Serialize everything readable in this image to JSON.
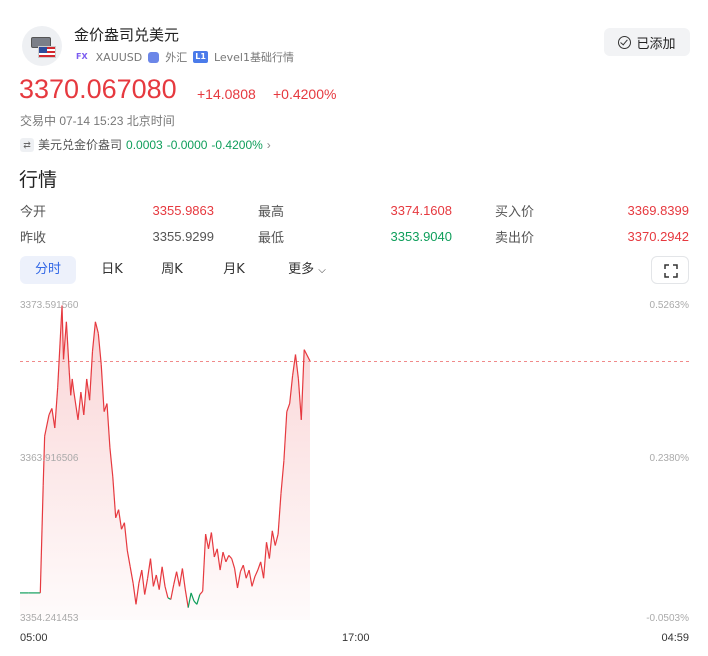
{
  "header": {
    "name": "金价盎司兑美元",
    "tag_fx": "FX",
    "code": "XAUUSD",
    "market": "外汇",
    "level_tag": "L1",
    "level": "Level1基础行情",
    "added_label": "已添加"
  },
  "quote": {
    "price": "3370.067080",
    "change": "+14.0808",
    "change_pct": "+0.4200%",
    "status": "交易中 07-14 15:23 北京时间"
  },
  "related": {
    "name": "美元兑金价盎司",
    "price": "0.0003",
    "change": "-0.0000",
    "change_pct": "-0.4200%"
  },
  "section_title": "行情",
  "stats": {
    "open_label": "今开",
    "open": "3355.9863",
    "high_label": "最高",
    "high": "3374.1608",
    "bid_label": "买入价",
    "bid": "3369.8399",
    "prev_label": "昨收",
    "prev": "3355.9299",
    "low_label": "最低",
    "low": "3353.9040",
    "ask_label": "卖出价",
    "ask": "3370.2942"
  },
  "tabs": {
    "intraday": "分时",
    "day": "日K",
    "week": "周K",
    "month": "月K",
    "more": "更多"
  },
  "colors": {
    "up": "#e6393f",
    "down": "#0f9e5b",
    "accent": "#3268e6"
  },
  "chart_data": {
    "type": "line",
    "y_left_ticks": [
      "3373.591560",
      "3363.916506",
      "3354.241453"
    ],
    "y_right_ticks": [
      "0.5263%",
      "0.2380%",
      "-0.0503%"
    ],
    "x_ticks": [
      "05:00",
      "17:00",
      "04:59"
    ],
    "ylim": [
      3354.241453,
      3373.59156
    ],
    "prev_close": 3355.9299,
    "current": 3370.06708,
    "x": [
      0.0,
      0.03,
      0.07,
      0.08,
      0.085,
      0.1,
      0.11,
      0.12,
      0.13,
      0.145,
      0.15,
      0.16,
      0.17,
      0.175,
      0.18,
      0.185,
      0.2,
      0.21,
      0.22,
      0.23,
      0.24,
      0.25,
      0.26,
      0.27,
      0.28,
      0.29,
      0.3,
      0.31,
      0.32,
      0.33,
      0.34,
      0.35,
      0.36,
      0.37,
      0.38,
      0.39,
      0.4,
      0.41,
      0.42,
      0.43,
      0.44,
      0.45,
      0.46,
      0.47,
      0.48,
      0.49,
      0.5,
      0.51,
      0.52,
      0.53,
      0.54,
      0.55,
      0.56,
      0.57,
      0.58,
      0.59,
      0.6,
      0.61,
      0.62,
      0.63,
      0.64,
      0.65,
      0.66,
      0.67,
      0.68,
      0.69,
      0.7,
      0.71,
      0.72,
      0.73,
      0.74,
      0.75,
      0.76,
      0.77,
      0.78,
      0.79,
      0.8,
      0.81,
      0.82,
      0.83,
      0.84,
      0.85,
      0.86,
      0.87,
      0.88,
      0.89,
      0.9,
      0.91,
      0.92,
      0.93,
      0.94,
      0.95,
      0.96,
      0.97,
      0.98,
      1.0
    ],
    "y": [
      3355.9,
      3355.9,
      3355.9,
      3362.5,
      3365.5,
      3366.8,
      3367.2,
      3366.0,
      3368.5,
      3373.5,
      3370.2,
      3372.5,
      3369.4,
      3368.0,
      3369.0,
      3368.3,
      3366.5,
      3368.2,
      3366.8,
      3369.0,
      3367.7,
      3370.7,
      3372.5,
      3371.8,
      3369.9,
      3367.0,
      3367.5,
      3364.8,
      3363.0,
      3360.5,
      3361.0,
      3359.8,
      3360.2,
      3358.5,
      3357.5,
      3356.5,
      3355.2,
      3356.5,
      3357.3,
      3355.8,
      3356.8,
      3358.0,
      3356.3,
      3357.0,
      3356.1,
      3357.5,
      3356.3,
      3355.6,
      3355.5,
      3356.4,
      3357.2,
      3356.3,
      3357.4,
      3356.1,
      3355.0,
      3355.9,
      3355.4,
      3355.2,
      3355.8,
      3356.0,
      3359.5,
      3358.6,
      3359.6,
      3358.1,
      3358.6,
      3357.3,
      3358.4,
      3357.8,
      3358.2,
      3358.0,
      3357.4,
      3356.2,
      3357.2,
      3357.6,
      3356.8,
      3357.3,
      3356.3,
      3356.9,
      3357.3,
      3357.8,
      3356.8,
      3359.0,
      3358.0,
      3359.7,
      3358.8,
      3359.5,
      3362.0,
      3364.0,
      3367.0,
      3367.5,
      3369.2,
      3370.5,
      3369.0,
      3366.5,
      3370.8,
      3370.1
    ]
  }
}
